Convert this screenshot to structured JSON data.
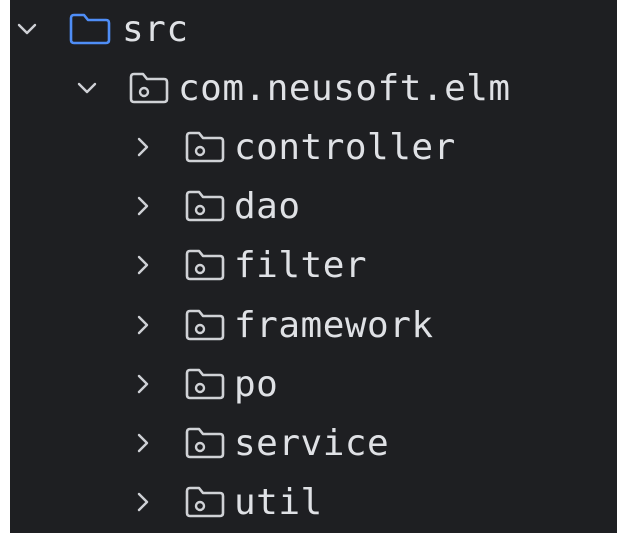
{
  "project_tree": {
    "root": {
      "label": "src",
      "expanded": true,
      "icon": "source-folder-icon",
      "color": "#4f8ef7"
    },
    "package": {
      "label": "com.neusoft.elm",
      "expanded": true,
      "icon": "package-folder-icon"
    },
    "children": [
      {
        "label": "controller",
        "expanded": false,
        "icon": "package-folder-icon"
      },
      {
        "label": "dao",
        "expanded": false,
        "icon": "package-folder-icon"
      },
      {
        "label": "filter",
        "expanded": false,
        "icon": "package-folder-icon"
      },
      {
        "label": "framework",
        "expanded": false,
        "icon": "package-folder-icon"
      },
      {
        "label": "po",
        "expanded": false,
        "icon": "package-folder-icon"
      },
      {
        "label": "service",
        "expanded": false,
        "icon": "package-folder-icon"
      },
      {
        "label": "util",
        "expanded": false,
        "icon": "package-folder-icon"
      }
    ]
  },
  "colors": {
    "background": "#1e1f22",
    "text": "#dfe1e5",
    "chevron": "#cfd1d6",
    "source_folder": "#4f8ef7",
    "package_folder": "#d0d2d6"
  }
}
